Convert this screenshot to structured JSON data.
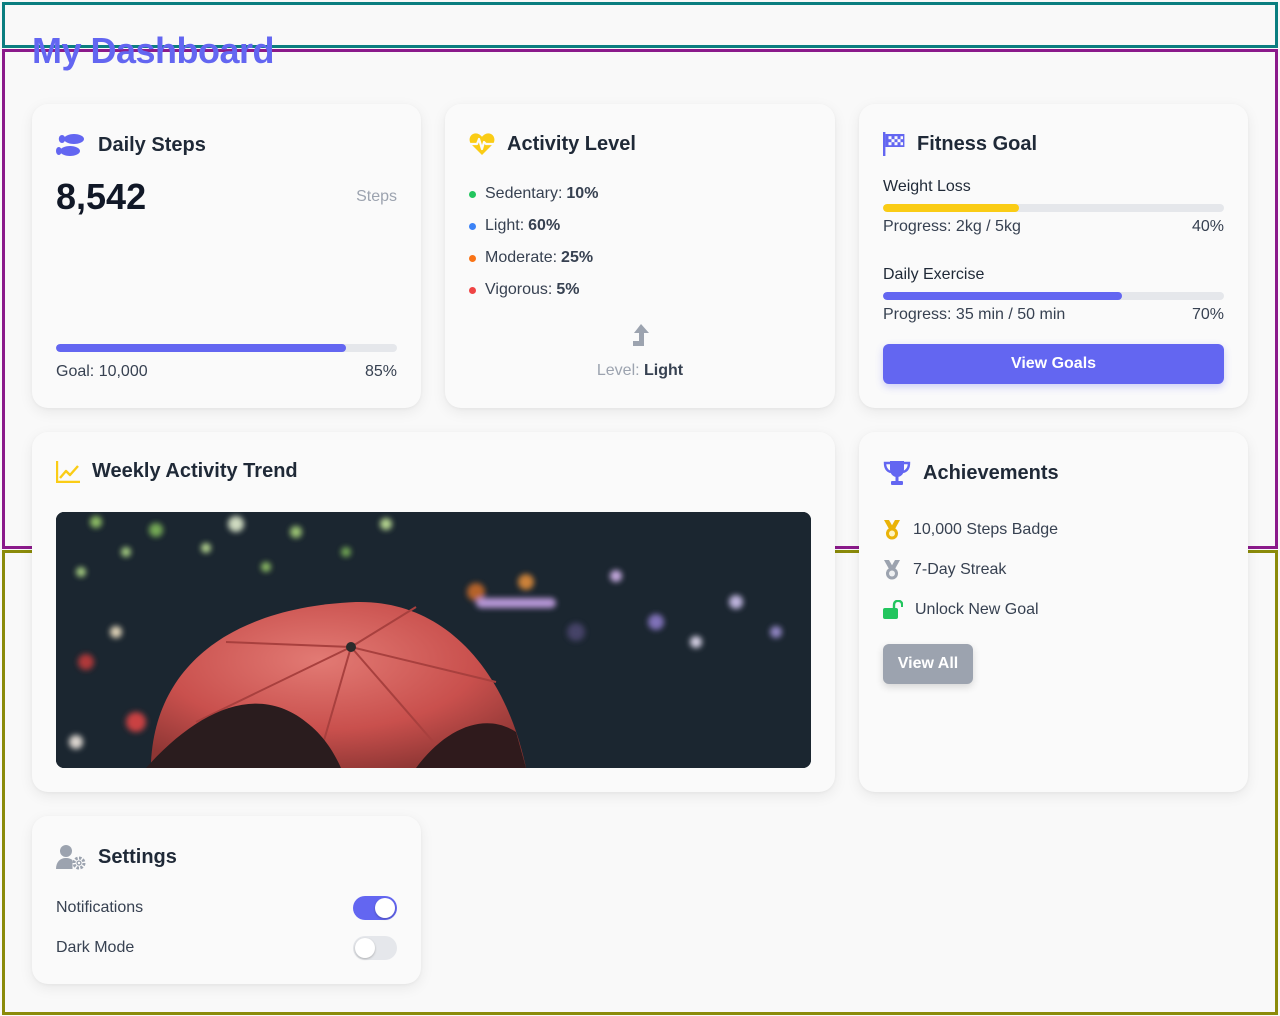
{
  "page_title": "My Dashboard",
  "colors": {
    "accent": "#6366f1",
    "yellow": "#facc15",
    "green": "#22c55e",
    "gray": "#9ca3af"
  },
  "daily_steps": {
    "title": "Daily Steps",
    "icon": "shoe-prints-icon",
    "value": "8,542",
    "unit": "Steps",
    "goal": "Goal: 10,000",
    "percent_label": "85%",
    "progress": 0.85
  },
  "activity": {
    "title": "Activity Level",
    "icon": "heartbeat-icon",
    "items": [
      {
        "label": "Sedentary:",
        "value": "10%",
        "color": "#22c55e"
      },
      {
        "label": "Light:",
        "value": "60%",
        "color": "#3b82f6"
      },
      {
        "label": "Moderate:",
        "value": "25%",
        "color": "#f97316"
      },
      {
        "label": "Vigorous:",
        "value": "5%",
        "color": "#ef4444"
      }
    ],
    "level_label": "Level:",
    "level_value": "Light"
  },
  "fitness_goal": {
    "title": "Fitness Goal",
    "icon": "flag-checkered-icon",
    "goals": [
      {
        "name": "Weight Loss",
        "progress_text": "Progress: 2kg / 5kg",
        "percent_label": "40%",
        "progress": 0.4,
        "color": "#facc15"
      },
      {
        "name": "Daily Exercise",
        "progress_text": "Progress: 35 min / 50 min",
        "percent_label": "70%",
        "progress": 0.7,
        "color": "#6366f1"
      }
    ],
    "button": "View Goals"
  },
  "weekly": {
    "title": "Weekly Activity Trend",
    "icon": "chart-line-icon"
  },
  "achievements": {
    "title": "Achievements",
    "icon": "trophy-icon",
    "items": [
      {
        "label": "10,000 Steps Badge",
        "icon": "medal-gold-icon"
      },
      {
        "label": "7-Day Streak",
        "icon": "medal-silver-icon"
      },
      {
        "label": "Unlock New Goal",
        "icon": "unlock-icon"
      }
    ],
    "button": "View All"
  },
  "settings": {
    "title": "Settings",
    "icon": "user-cog-icon",
    "rows": [
      {
        "label": "Notifications",
        "on": true
      },
      {
        "label": "Dark Mode",
        "on": false
      }
    ]
  }
}
